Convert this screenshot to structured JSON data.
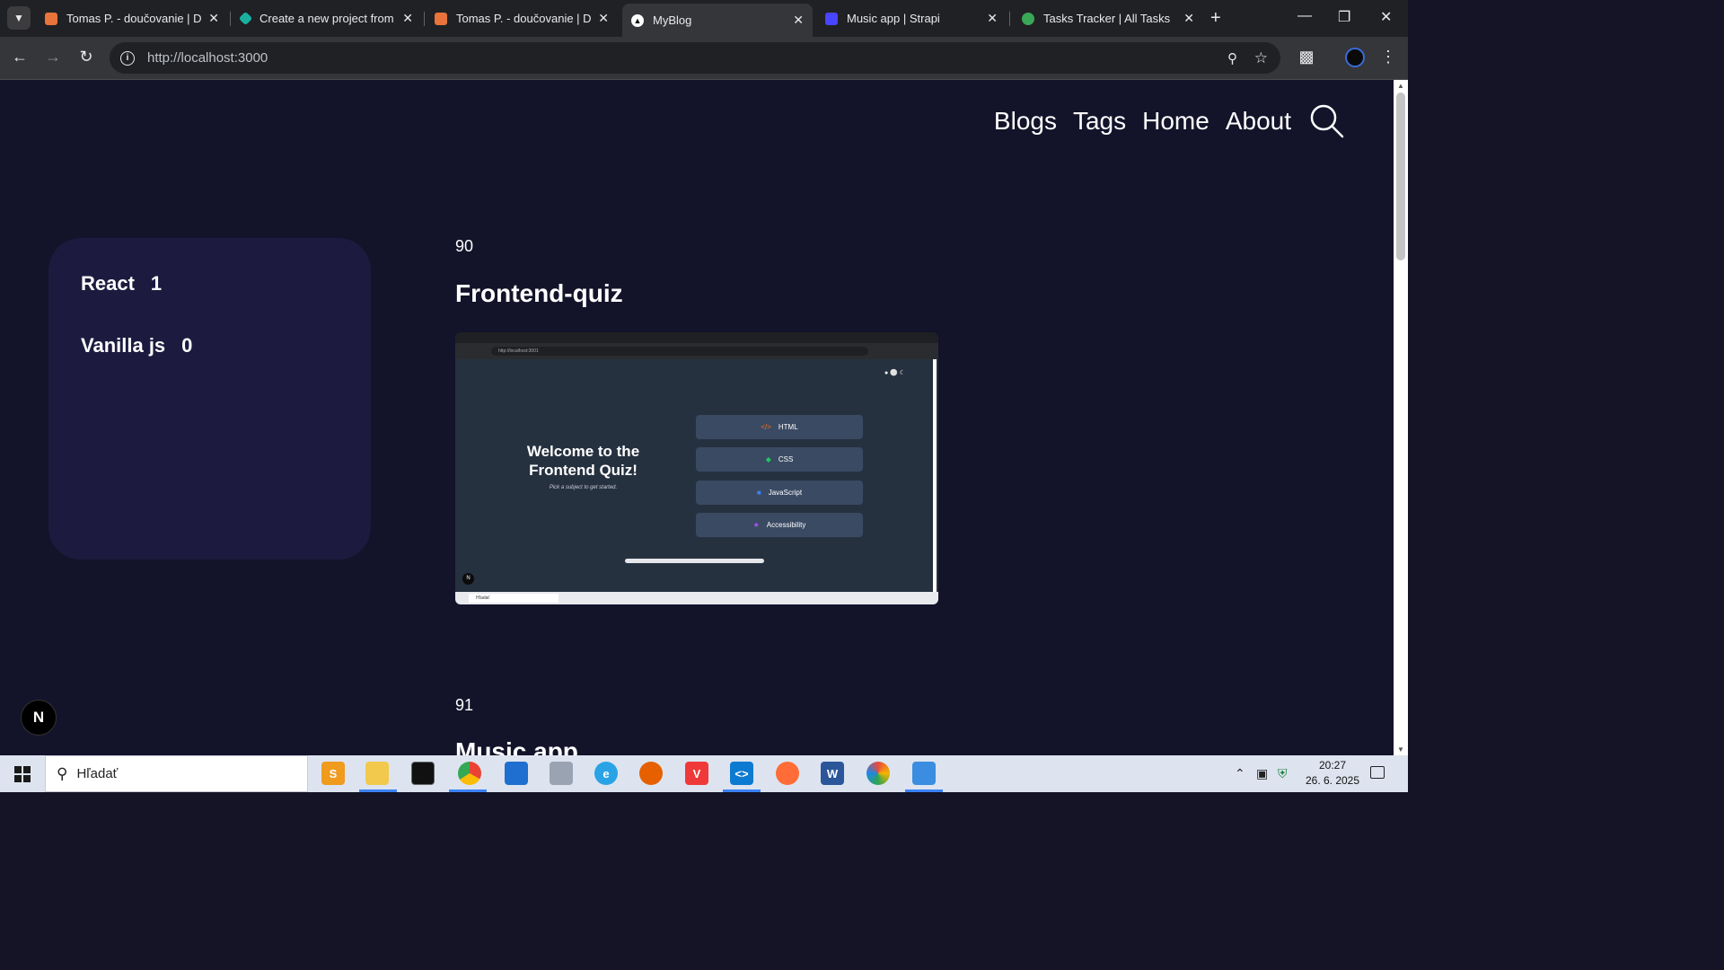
{
  "browser": {
    "tabs": [
      {
        "title": "Tomas P. - doučovanie | Do",
        "favicon_color": "#e8743b",
        "active": false
      },
      {
        "title": "Create a new project from",
        "favicon_color": "#1ab0a0",
        "active": false
      },
      {
        "title": "Tomas P. - doučovanie | Do",
        "favicon_color": "#e8743b",
        "active": false
      },
      {
        "title": "MyBlog",
        "favicon_color": "#000000",
        "active": true
      },
      {
        "title": "Music app | Strapi",
        "favicon_color": "#4945ff",
        "active": false
      },
      {
        "title": "Tasks Tracker | All Tasks",
        "favicon_color": "#3aa657",
        "active": false
      }
    ],
    "url": "http://localhost:3000"
  },
  "nav": {
    "links": [
      "Blogs",
      "Tags",
      "Home",
      "About"
    ]
  },
  "tags": [
    {
      "name": "React",
      "count": "1"
    },
    {
      "name": "Vanilla js",
      "count": "0"
    }
  ],
  "posts": [
    {
      "number": "90",
      "title": "Frontend-quiz"
    },
    {
      "number": "91",
      "title": "Music app"
    }
  ],
  "screenshot": {
    "url": "http://localhost:3001",
    "heading": "Welcome to the Frontend Quiz!",
    "subtitle": "Pick a subject to get started.",
    "buttons": [
      "HTML",
      "CSS",
      "JavaScript",
      "Accessibility"
    ],
    "search_placeholder": "Hľadať"
  },
  "next_badge": "N",
  "taskbar": {
    "search_placeholder": "Hľadať",
    "time": "20:27",
    "date": "26. 6. 2025"
  },
  "colors": {
    "page_bg": "#13132a",
    "tag_card_bg": "#1c1b3f",
    "accent": "#3b82f6"
  }
}
